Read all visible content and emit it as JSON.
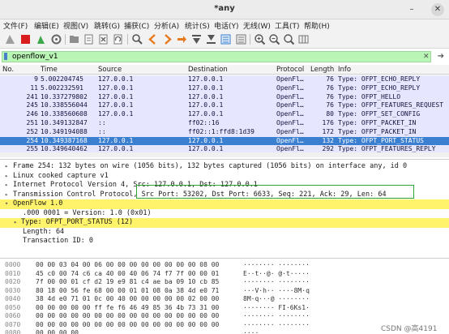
{
  "window": {
    "title": "*any",
    "minimize_glyph": "–",
    "close_glyph": "✕"
  },
  "menu": [
    "文件(F)",
    "编辑(E)",
    "视图(V)",
    "跳转(G)",
    "捕获(C)",
    "分析(A)",
    "统计(S)",
    "电话(Y)",
    "无线(W)",
    "工具(T)",
    "帮助(H)"
  ],
  "toolbar": {
    "icons": [
      "shark-fin-start-icon",
      "stop-capture-icon",
      "restart-capture-icon",
      "capture-options-icon",
      "open-file-icon",
      "file-icon",
      "close-file-icon",
      "reload-icon",
      "find-packet-icon",
      "go-back-icon",
      "go-forward-icon",
      "go-to-packet-icon",
      "first-packet-icon",
      "last-packet-icon",
      "autoscroll-icon",
      "colorize-icon",
      "zoom-in-icon",
      "zoom-out-icon",
      "normal-size-icon",
      "resize-columns-icon"
    ],
    "colors": {
      "accent_blue": "#3a7fd0",
      "stop_red": "#d71d1d",
      "arrow_orange": "#e87a1e",
      "fin_green": "#3aa84a"
    }
  },
  "filter": {
    "value": "openflow_v1",
    "clear_glyph": "✕",
    "apply_glyph": "➔",
    "bg_color": "#b9f5b5"
  },
  "packet_list": {
    "columns": [
      "No.",
      "Time",
      "Source",
      "Destination",
      "Protocol",
      "Length",
      "Info"
    ],
    "rows": [
      {
        "no": "9",
        "time": "5.002204745",
        "src": "127.0.0.1",
        "dst": "127.0.0.1",
        "proto": "OpenFl…",
        "len": "76",
        "info": "Type: OFPT_ECHO_REPLY"
      },
      {
        "no": "11",
        "time": "5.002232591",
        "src": "127.0.0.1",
        "dst": "127.0.0.1",
        "proto": "OpenFl…",
        "len": "76",
        "info": "Type: OFPT_ECHO_REPLY"
      },
      {
        "no": "241",
        "time": "10.337279802",
        "src": "127.0.0.1",
        "dst": "127.0.0.1",
        "proto": "OpenFl…",
        "len": "76",
        "info": "Type: OFPT_HELLO"
      },
      {
        "no": "245",
        "time": "10.338556044",
        "src": "127.0.0.1",
        "dst": "127.0.0.1",
        "proto": "OpenFl…",
        "len": "76",
        "info": "Type: OFPT_FEATURES_REQUEST"
      },
      {
        "no": "246",
        "time": "10.338560608",
        "src": "127.0.0.1",
        "dst": "127.0.0.1",
        "proto": "OpenFl…",
        "len": "80",
        "info": "Type: OFPT_SET_CONFIG"
      },
      {
        "no": "251",
        "time": "10.349132847",
        "src": "::",
        "dst": "ff02::16",
        "proto": "OpenFl…",
        "len": "176",
        "info": "Type: OFPT_PACKET_IN"
      },
      {
        "no": "252",
        "time": "10.349194088",
        "src": "::",
        "dst": "ff02::1:ffd8:1d39",
        "proto": "OpenFl…",
        "len": "172",
        "info": "Type: OFPT_PACKET_IN"
      },
      {
        "no": "254",
        "time": "10.349387168",
        "src": "127.0.0.1",
        "dst": "127.0.0.1",
        "proto": "OpenFl…",
        "len": "132",
        "info": "Type: OFPT_PORT_STATUS",
        "selected": true
      },
      {
        "no": "255",
        "time": "10.349640462",
        "src": "127.0.0.1",
        "dst": "127.0.0.1",
        "proto": "OpenFl…",
        "len": "292",
        "info": "Type: OFPT_FEATURES_REPLY"
      }
    ]
  },
  "details": {
    "lines": [
      {
        "arrow": "▸",
        "text": "Frame 254: 132 bytes on wire (1056 bits), 132 bytes captured (1056 bits) on interface any, id 0",
        "level": 0
      },
      {
        "arrow": "▸",
        "text": "Linux cooked capture v1",
        "level": 0
      },
      {
        "arrow": "▸",
        "text": "Internet Protocol Version 4, Src: 127.0.0.1, Dst: 127.0.0.1",
        "level": 0
      },
      {
        "arrow": "▸",
        "text": "Transmission Control Protocol, Src Port: 53202, Dst Port: 6633, Seq: 221, Ack: 29, Len: 64",
        "level": 0
      },
      {
        "arrow": "▾",
        "text": "OpenFlow 1.0",
        "level": 0,
        "highlight": true
      },
      {
        "arrow": "",
        "text": ".000 0001 = Version: 1.0 (0x01)",
        "level": 2
      },
      {
        "arrow": "▸",
        "text": "Type: OFPT_PORT_STATUS (12)",
        "level": 1,
        "highlight": true
      },
      {
        "arrow": "",
        "text": "Length: 64",
        "level": 2
      },
      {
        "arrow": "",
        "text": "Transaction ID: 0",
        "level": 2
      }
    ]
  },
  "hex": {
    "rows": [
      {
        "off": "0000",
        "bytes": "00 00 03 04 00 06 00 00  00 00 00 00 00 00 08 00",
        "ascii": "········ ········"
      },
      {
        "off": "0010",
        "bytes": "45 c0 00 74 c6 ca 40 00  40 06 74 f7 7f 00 00 01",
        "ascii": "E··t··@· @·t·····"
      },
      {
        "off": "0020",
        "bytes": "7f 00 00 01 cf d2 19 e9  81 c4 ae ba 09 10 cb 85",
        "ascii": "········ ········"
      },
      {
        "off": "0030",
        "bytes": "80 18 00 56 fe 68 00 00  01 01 08 0a 38 4d e0 71",
        "ascii": "···V·h·· ····8M·q"
      },
      {
        "off": "0040",
        "bytes": "38 4d e0 71 01 0c 00 40  00 00 00 00 00 02 00 00",
        "ascii": "8M·q···@ ········"
      },
      {
        "off": "0050",
        "bytes": "00 00 00 00 00 ff fe f6  46 49 85 36 4b 73 31 00",
        "ascii": "········ FI·6Ks1·"
      },
      {
        "off": "0060",
        "bytes": "00 00 00 00 00 00 00 00  00 00 00 00 00 00 00 00",
        "ascii": "········ ········"
      },
      {
        "off": "0070",
        "bytes": "00 00 00 00 00 00 00 00  00 00 00 00 00 00 00 00",
        "ascii": "········ ········"
      },
      {
        "off": "0080",
        "bytes": "00 00 00 00",
        "ascii": "····"
      }
    ]
  },
  "watermark": "CSDN @高4191"
}
